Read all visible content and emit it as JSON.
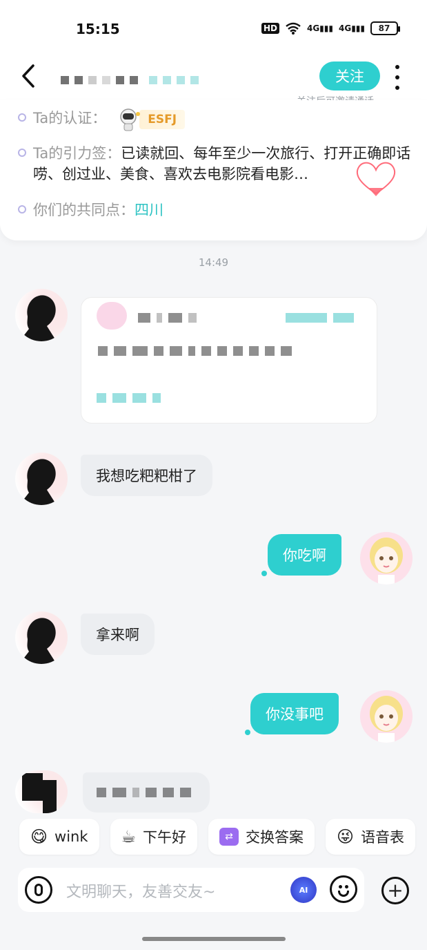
{
  "status_bar": {
    "time": "15:15",
    "hd": "HD",
    "signal1": "4G",
    "signal2": "4G",
    "battery": "87"
  },
  "header": {
    "follow_label": "关注",
    "follow_tip": "关注后可邀请通话"
  },
  "profile": {
    "cert_label": "Ta的认证：",
    "cert_badge": "ESFJ",
    "tags_label": "Ta的引力签：",
    "tags_text": "已读就回、每年至少一次旅行、打开正确即话唠、创过业、美食、喜欢去电影院看电影…",
    "common_label": "你们的共同点：",
    "common_value": "四川"
  },
  "chat": {
    "timestamp": "14:49",
    "messages": [
      {
        "side": "left",
        "text": "我想吃粑粑柑了"
      },
      {
        "side": "right",
        "text": "你吃啊"
      },
      {
        "side": "left",
        "text": "拿来啊"
      },
      {
        "side": "right",
        "text": "你没事吧"
      }
    ]
  },
  "quick_replies": [
    {
      "icon": "😋",
      "label": "wink"
    },
    {
      "icon": "☕",
      "label": "下午好"
    },
    {
      "icon": "⇄",
      "label": "交换答案"
    },
    {
      "icon": "😜",
      "label": "语音表"
    }
  ],
  "input": {
    "placeholder": "文明聊天，友善交友~",
    "ai_label": "AI"
  },
  "colors": {
    "accent": "#2ecfcf",
    "bubble_left": "#eceef1",
    "badge_text": "#e59a2a"
  }
}
